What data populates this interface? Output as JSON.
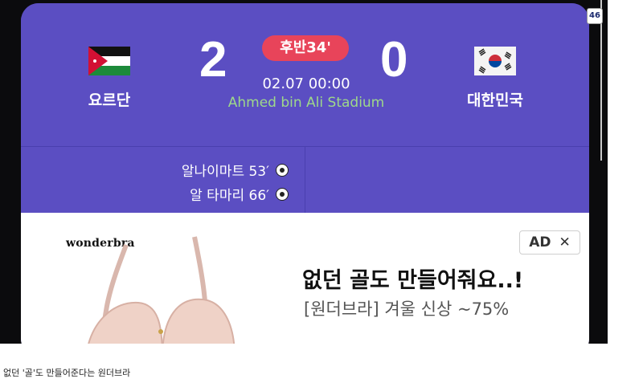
{
  "match": {
    "status": "후반34'",
    "datetime": "02.07 00:00",
    "stadium": "Ahmed bin Ali Stadium",
    "home": {
      "name": "요르단",
      "score": "2",
      "flag": "jordan-flag-icon"
    },
    "away": {
      "name": "대한민국",
      "score": "0",
      "flag": "korea-flag-icon"
    },
    "scorers": [
      {
        "text": "알나이마트 53′",
        "icon": "soccer-ball-icon"
      },
      {
        "text": "알 타마리 66′",
        "icon": "soccer-ball-icon"
      }
    ]
  },
  "ad": {
    "brand": "wonderbra",
    "badge_label": "AD",
    "close_label": "✕",
    "headline": "없던 골도 만들어줘요..!",
    "subline": "[원더브라] 겨울 신상 ~75%"
  },
  "page_counter": "46",
  "caption": "없던 '골'도 만들어준다는 원더브라",
  "colors": {
    "panel": "#5b4ec2",
    "status_badge": "#e8445a",
    "stadium_text": "#9ed88a"
  }
}
